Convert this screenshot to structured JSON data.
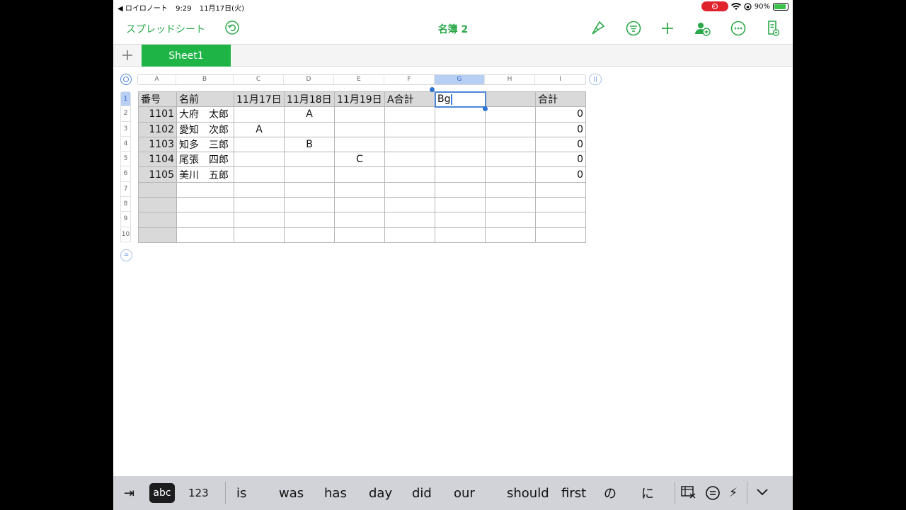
{
  "status_bar": {
    "back_app": "◀ ロイロノート",
    "time": "9:29",
    "date": "11月17日(火)",
    "battery": "90%",
    "battery_level": 0.9
  },
  "toolbar": {
    "back_label": "スプレッドシート",
    "doc_title": "名簿 2"
  },
  "sheet_tabs": {
    "add_label": "+",
    "tabs": [
      "Sheet1"
    ]
  },
  "columns": [
    "A",
    "B",
    "C",
    "D",
    "E",
    "F",
    "G",
    "H",
    "I"
  ],
  "selected_column": "G",
  "rows": [
    "1",
    "2",
    "3",
    "4",
    "5",
    "6",
    "7",
    "8",
    "9",
    "10"
  ],
  "selected_row": "1",
  "table": {
    "header": [
      "番号",
      "名前",
      "11月17日",
      "11月18日",
      "11月19日",
      "A合計",
      "Bg",
      "",
      "合計"
    ],
    "body": [
      [
        "1101",
        "大府　太郎",
        "",
        "A",
        "",
        "",
        "",
        "",
        "0"
      ],
      [
        "1102",
        "愛知　次郎",
        "A",
        "",
        "",
        "",
        "",
        "",
        "0"
      ],
      [
        "1103",
        "知多　三郎",
        "",
        "B",
        "",
        "",
        "",
        "",
        "0"
      ],
      [
        "1104",
        "尾張　四郎",
        "",
        "",
        "C",
        "",
        "",
        "",
        "0"
      ],
      [
        "1105",
        "美川　五郎",
        "",
        "",
        "",
        "",
        "",
        "",
        "0"
      ],
      [
        "",
        "",
        "",
        "",
        "",
        "",
        "",
        "",
        ""
      ],
      [
        "",
        "",
        "",
        "",
        "",
        "",
        "",
        "",
        ""
      ],
      [
        "",
        "",
        "",
        "",
        "",
        "",
        "",
        "",
        ""
      ],
      [
        "",
        "",
        "",
        "",
        "",
        "",
        "",
        "",
        ""
      ]
    ]
  },
  "keyboard_bar": {
    "tab_symbol": "⇥",
    "abc_label": "abc",
    "num_label": "123",
    "suggestions": [
      "is",
      "was",
      "has",
      "day",
      "did",
      "our",
      "should",
      "first",
      "の",
      "に"
    ],
    "lightning": "⚡"
  },
  "colors": {
    "accent_green": "#2ba84a",
    "sheet_tab_green": "#1eb546",
    "selection_blue": "#4c86d6"
  }
}
